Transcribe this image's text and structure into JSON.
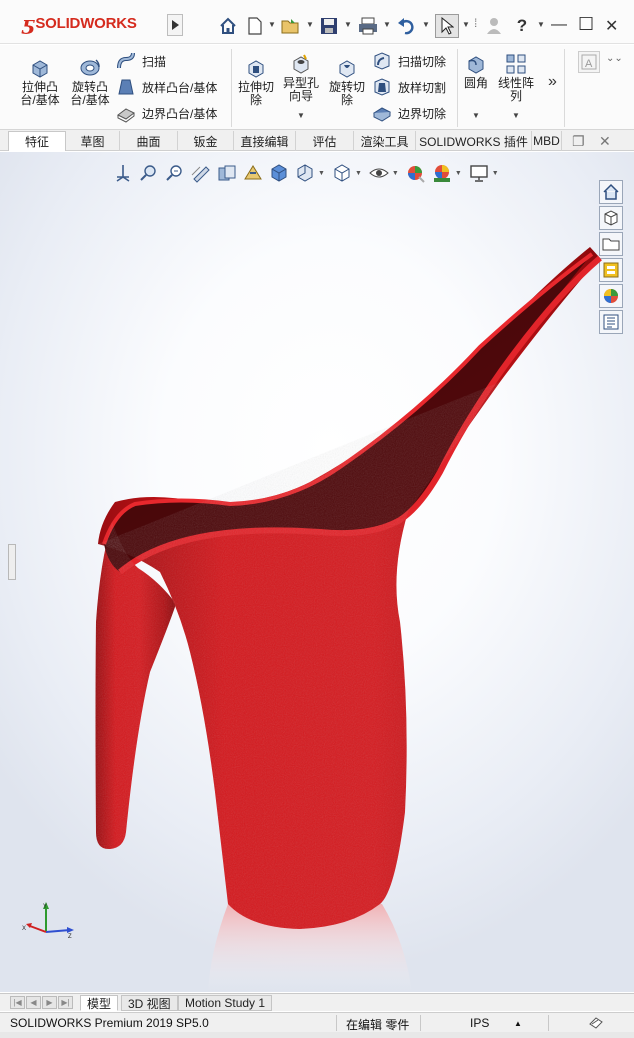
{
  "app": {
    "logo_text": "SOLIDWORKS",
    "logo_ds": "ƽ"
  },
  "quick_access": {
    "icons": [
      "home-icon",
      "new-document-icon",
      "open-icon",
      "save-icon",
      "print-icon",
      "undo-icon",
      "select-icon",
      "help-icon"
    ]
  },
  "window": {
    "close": "✕",
    "maximize": "☐",
    "minimize": "—"
  },
  "ribbon": {
    "extrude_boss": "拉伸凸\n台/基体",
    "revolve_boss": "旋转凸\n台/基体",
    "sweep": "扫描",
    "loft_boss": "放样凸台/基体",
    "boundary_boss": "边界凸台/基体",
    "extrude_cut": "拉伸切\n除",
    "hole_wizard": "异型孔\n向导",
    "revolve_cut": "旋转切\n除",
    "sweep_cut": "扫描切除",
    "loft_cut": "放样切割",
    "boundary_cut": "边界切除",
    "fillet": "圆角",
    "linear_pattern": "线性阵\n列",
    "more": "»"
  },
  "tabs": [
    {
      "label": "特征",
      "active": true
    },
    {
      "label": "草图",
      "active": false
    },
    {
      "label": "曲面",
      "active": false
    },
    {
      "label": "钣金",
      "active": false
    },
    {
      "label": "直接编辑",
      "active": false
    },
    {
      "label": "评估",
      "active": false
    },
    {
      "label": "渲染工具",
      "active": false
    },
    {
      "label": "SOLIDWORKS 插件",
      "active": false
    },
    {
      "label": "MBD",
      "active": false
    }
  ],
  "model": {
    "body_color": "#d0161b",
    "reflection_color": "#f3b9bb"
  },
  "bottom_tabs": [
    "模型",
    "3D 视图",
    "Motion Study 1"
  ],
  "status": {
    "product": "SOLIDWORKS Premium 2019 SP5.0",
    "mode": "在编辑 零件",
    "units": "IPS"
  }
}
